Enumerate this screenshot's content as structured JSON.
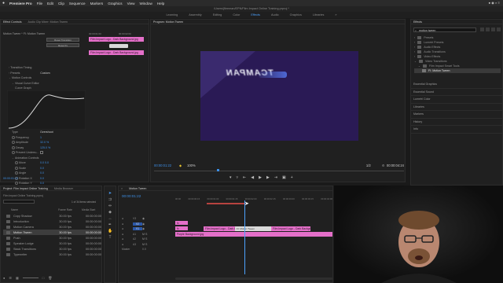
{
  "menubar": {
    "app_name": "Premiere Pro",
    "items": [
      "File",
      "Edit",
      "Clip",
      "Sequence",
      "Markers",
      "Graphics",
      "View",
      "Window",
      "Help"
    ],
    "right_status": "● ◉ ⌕ ≡"
  },
  "titlebar": {
    "path": "/Users/jfleeman/EPN/Film Impact Online Training.prproj *"
  },
  "workspaces": {
    "items": [
      "Learning",
      "Assembly",
      "Editing",
      "Color",
      "Effects",
      "Audio",
      "Graphics",
      "Libraries"
    ],
    "active": "Effects"
  },
  "effect_controls": {
    "tabs": [
      "Effect Controls",
      "Audio Clip Mixer: Motion Tween"
    ],
    "active_tab": "Effect Controls",
    "clip_label": "Motion Tween * FI: Motion Tween",
    "mini_timecodes": [
      "00:00:01:00",
      "00:00:02:00"
    ],
    "mini_clip": "Film Impact Logo - Dark Background.jpg",
    "mini_buttons": [
      "Reset Transition",
      "Reset Fx"
    ],
    "rows": [
      {
        "label": "Transition Timing",
        "value": ""
      },
      {
        "label": "Presets",
        "value": "Custom"
      },
      {
        "label": "Motion Controls",
        "value": ""
      },
      {
        "label": "Visual Curve Editor",
        "value": ""
      },
      {
        "label": "Curve Graph",
        "value": ""
      }
    ],
    "params": [
      {
        "label": "Type",
        "value": "Overshoot"
      },
      {
        "label": "Frequency",
        "value": "1"
      },
      {
        "label": "Amplitude",
        "value": "32.0 %"
      },
      {
        "label": "Decay",
        "value": "125.0 %"
      },
      {
        "label": "Prevent Underru...",
        "value": ""
      },
      {
        "label": "Animation Controls",
        "value": ""
      },
      {
        "label": "Move",
        "value": "0.0   0.0"
      },
      {
        "label": "Scale",
        "value": "0.0"
      },
      {
        "label": "Angle",
        "value": "0.0"
      },
      {
        "label": "Rotation X",
        "value": "0.0"
      },
      {
        "label": "Rotation Y",
        "value": "0.0"
      },
      {
        "label": "Rotation Z",
        "value": "0.0"
      },
      {
        "label": "Cropping",
        "value": ""
      }
    ],
    "timecode": "00:00:01:13"
  },
  "program_monitor": {
    "title": "Program: Motion Tween",
    "frame_text": "TCAMPAN",
    "timecode": "00:00:01:22",
    "zoom": "100%",
    "resolution": "1/2",
    "duration": "00:00:04:24"
  },
  "effects_panel": {
    "title": "Effects",
    "search": "motion tween",
    "tree": [
      {
        "label": "Presets",
        "depth": 0
      },
      {
        "label": "Lumetri Presets",
        "depth": 0
      },
      {
        "label": "Audio Effects",
        "depth": 0
      },
      {
        "label": "Audio Transitions",
        "depth": 0
      },
      {
        "label": "Video Effects",
        "depth": 0
      },
      {
        "label": "Video Transitions",
        "depth": 0
      },
      {
        "label": "Film Impact Smart Tools",
        "depth": 1
      },
      {
        "label": "FI: Motion Tween",
        "depth": 2
      }
    ],
    "sections": [
      "Essential Graphics",
      "Essential Sound",
      "Lumetri Color",
      "Libraries",
      "Markers",
      "History",
      "Info"
    ]
  },
  "project_panel": {
    "tabs": [
      "Project: Film Impact Online Training",
      "Media Browser"
    ],
    "project_file": "Film Impact Online Training.prproj",
    "selection_info": "1 of 34 items selected",
    "columns": [
      "Name",
      "Frame Rate",
      "Media Start"
    ],
    "items": [
      {
        "name": "Copy Shadow",
        "rate": "30.00 fps",
        "start": "00:00:00:00"
      },
      {
        "name": "Introduction",
        "rate": "30.00 fps",
        "start": "00:00:00:00"
      },
      {
        "name": "Motion Camera",
        "rate": "30.00 fps",
        "start": "00:00:00:00"
      },
      {
        "name": "Motion Tween",
        "rate": "30.00 fps",
        "start": "00:00:00:00"
      },
      {
        "name": "Push",
        "rate": "30.00 fps",
        "start": "00:00:00:00"
      },
      {
        "name": "Speaker Lodge",
        "rate": "30.00 fps",
        "start": "00:00:00:00"
      },
      {
        "name": "Stack Transitions",
        "rate": "30.00 fps",
        "start": "00:00:00:00"
      },
      {
        "name": "Typewriter",
        "rate": "30.00 fps",
        "start": "00:00:00:00"
      }
    ]
  },
  "timeline": {
    "title": "Motion Tween",
    "timecode": "00:00:01:22",
    "ruler": [
      "00:00",
      "00:00:00:15",
      "00:00:01:00",
      "00:00:01:15",
      "00:00:02:00",
      "00:00:02:15",
      "00:00:03:00",
      "00:00:03:15",
      "00:00:04:00"
    ],
    "tracks": [
      "V3",
      "V2",
      "V1",
      "A1",
      "A2",
      "A3",
      "Master"
    ],
    "master_value": "0.0",
    "clips": {
      "v2_a": "Film Impact Logo - Dark Background.jpg",
      "v2_b": "FI: Motion Tween",
      "v2_c": "Film Impact Logo - Dark Background.jpg",
      "v1": "Purple Background.jpg",
      "small": "fx"
    }
  }
}
